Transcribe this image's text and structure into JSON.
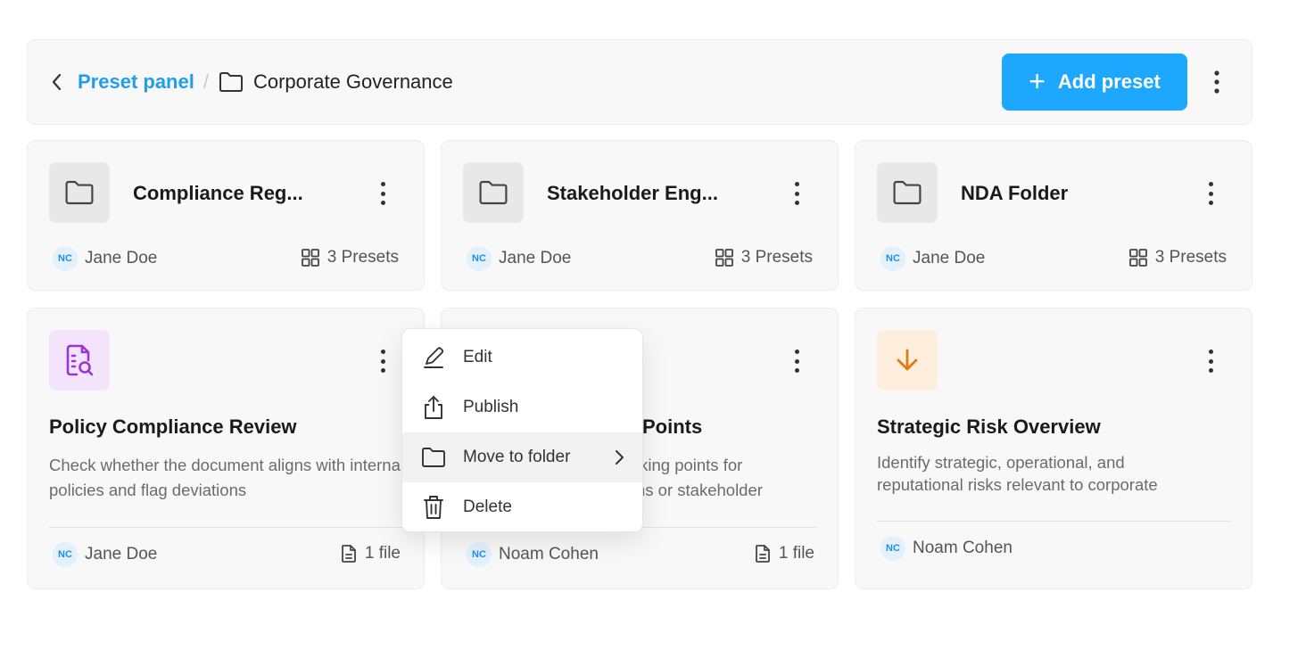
{
  "header": {
    "breadcrumb_root": "Preset panel",
    "breadcrumb_separator": "/",
    "breadcrumb_current": "Corporate Governance",
    "add_button_label": "Add preset"
  },
  "folders": [
    {
      "name": "Compliance Reg...",
      "owner_initials": "NC",
      "owner": "Jane Doe",
      "count": "3 Presets"
    },
    {
      "name": "Stakeholder Eng...",
      "owner_initials": "NC",
      "owner": "Jane Doe",
      "count": "3 Presets"
    },
    {
      "name": "NDA Folder",
      "owner_initials": "NC",
      "owner": "Jane Doe",
      "count": "3 Presets"
    }
  ],
  "presets": [
    {
      "title": "Policy Compliance Review",
      "desc": "Check whether the document aligns with internal policies and flag deviations",
      "owner_initials": "NC",
      "owner": "Jane Doe",
      "files": "1 file",
      "icon": "document-search-icon",
      "icon_color": "#9b35d6",
      "icon_bg": "#f3e4fb"
    },
    {
      "title": "Points",
      "desc_line1": "lking points for",
      "desc_line2": "ns or stakeholder",
      "owner_initials": "NC",
      "owner": "Noam Cohen",
      "files": "1 file"
    },
    {
      "title": "Strategic Risk Overview",
      "desc": "Identify strategic, operational, and reputational risks relevant to corporate",
      "owner_initials": "NC",
      "owner": "Noam Cohen",
      "icon": "arrow-down-icon",
      "icon_color": "#e07a10",
      "icon_bg": "#fdeedd"
    }
  ],
  "context_menu": {
    "items": [
      {
        "label": "Edit",
        "icon": "pencil-icon"
      },
      {
        "label": "Publish",
        "icon": "upload-icon"
      },
      {
        "label": "Move to folder",
        "icon": "folder-icon"
      },
      {
        "label": "Delete",
        "icon": "trash-icon"
      }
    ]
  },
  "colors": {
    "accent": "#1ea7ff",
    "link": "#1f9df0"
  }
}
